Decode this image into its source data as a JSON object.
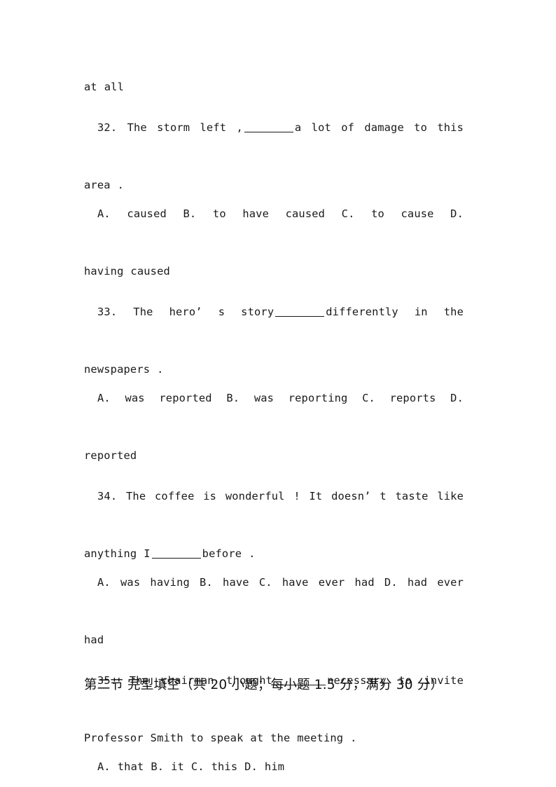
{
  "document": {
    "page_background": "#ffffff",
    "text_color": "#1a1a1a",
    "continuation_line": "at all",
    "questions": [
      {
        "number": "32.",
        "stem_before": "32.  The storm left ,",
        "stem_after": "a lot of damage to this",
        "stem_line2": "area .",
        "options_line1": "A.  caused   B.  to have caused   C.  to cause   D.",
        "options_line2": "having caused"
      },
      {
        "number": "33.",
        "stem_before": "33.  The hero’ s story",
        "stem_after": "differently in the",
        "stem_line2": "newspapers .",
        "options_line1": "A.  was reported  B.  was reporting C.  reports D.",
        "options_line2": "reported"
      },
      {
        "number": "34.",
        "stem_before": "34.  The coffee is wonderful ! It doesn’ t taste like",
        "stem_line2_before": "anything I",
        "stem_line2_after": "before .",
        "options_line1": "A.  was having B.  have  C.  have ever had D.  had ever",
        "options_line2": "had"
      },
      {
        "number": "35.",
        "stem_before": "35.  The chairman thought",
        "stem_after": "necessary to invite",
        "stem_line2": "Professor Smith to speak at the meeting .",
        "options_line1": "A.  that B.  it   C.  this D.  him"
      }
    ],
    "section_heading": {
      "label": "第二节 完型填空（共 20 小题；每小题 1.5 分，满分 30 分）"
    }
  }
}
